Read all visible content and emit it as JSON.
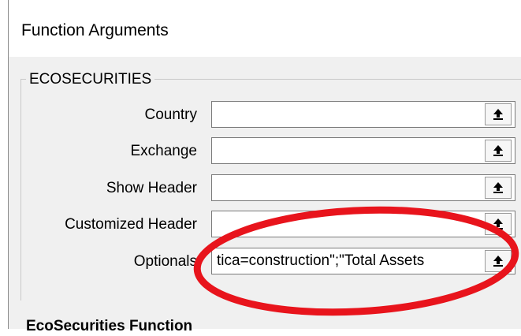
{
  "dialog": {
    "title": "Function Arguments"
  },
  "group": {
    "function_name": "ECOSECURITIES"
  },
  "arguments": [
    {
      "label": "Country",
      "value": "",
      "button_icon": "collapse-up-arrow-icon"
    },
    {
      "label": "Exchange",
      "value": "",
      "button_icon": "collapse-up-arrow-icon"
    },
    {
      "label": "Show Header",
      "value": "",
      "button_icon": "collapse-up-arrow-icon"
    },
    {
      "label": "Customized Header",
      "value": "",
      "button_icon": "collapse-up-arrow-icon"
    },
    {
      "label": "Optionals",
      "value": "tica=construction\";\"Total Assets",
      "button_icon": "collapse-up-arrow-icon"
    }
  ],
  "footer": {
    "description_title": "EcoSecurities Function"
  },
  "annotation": {
    "color": "#e8141c"
  }
}
